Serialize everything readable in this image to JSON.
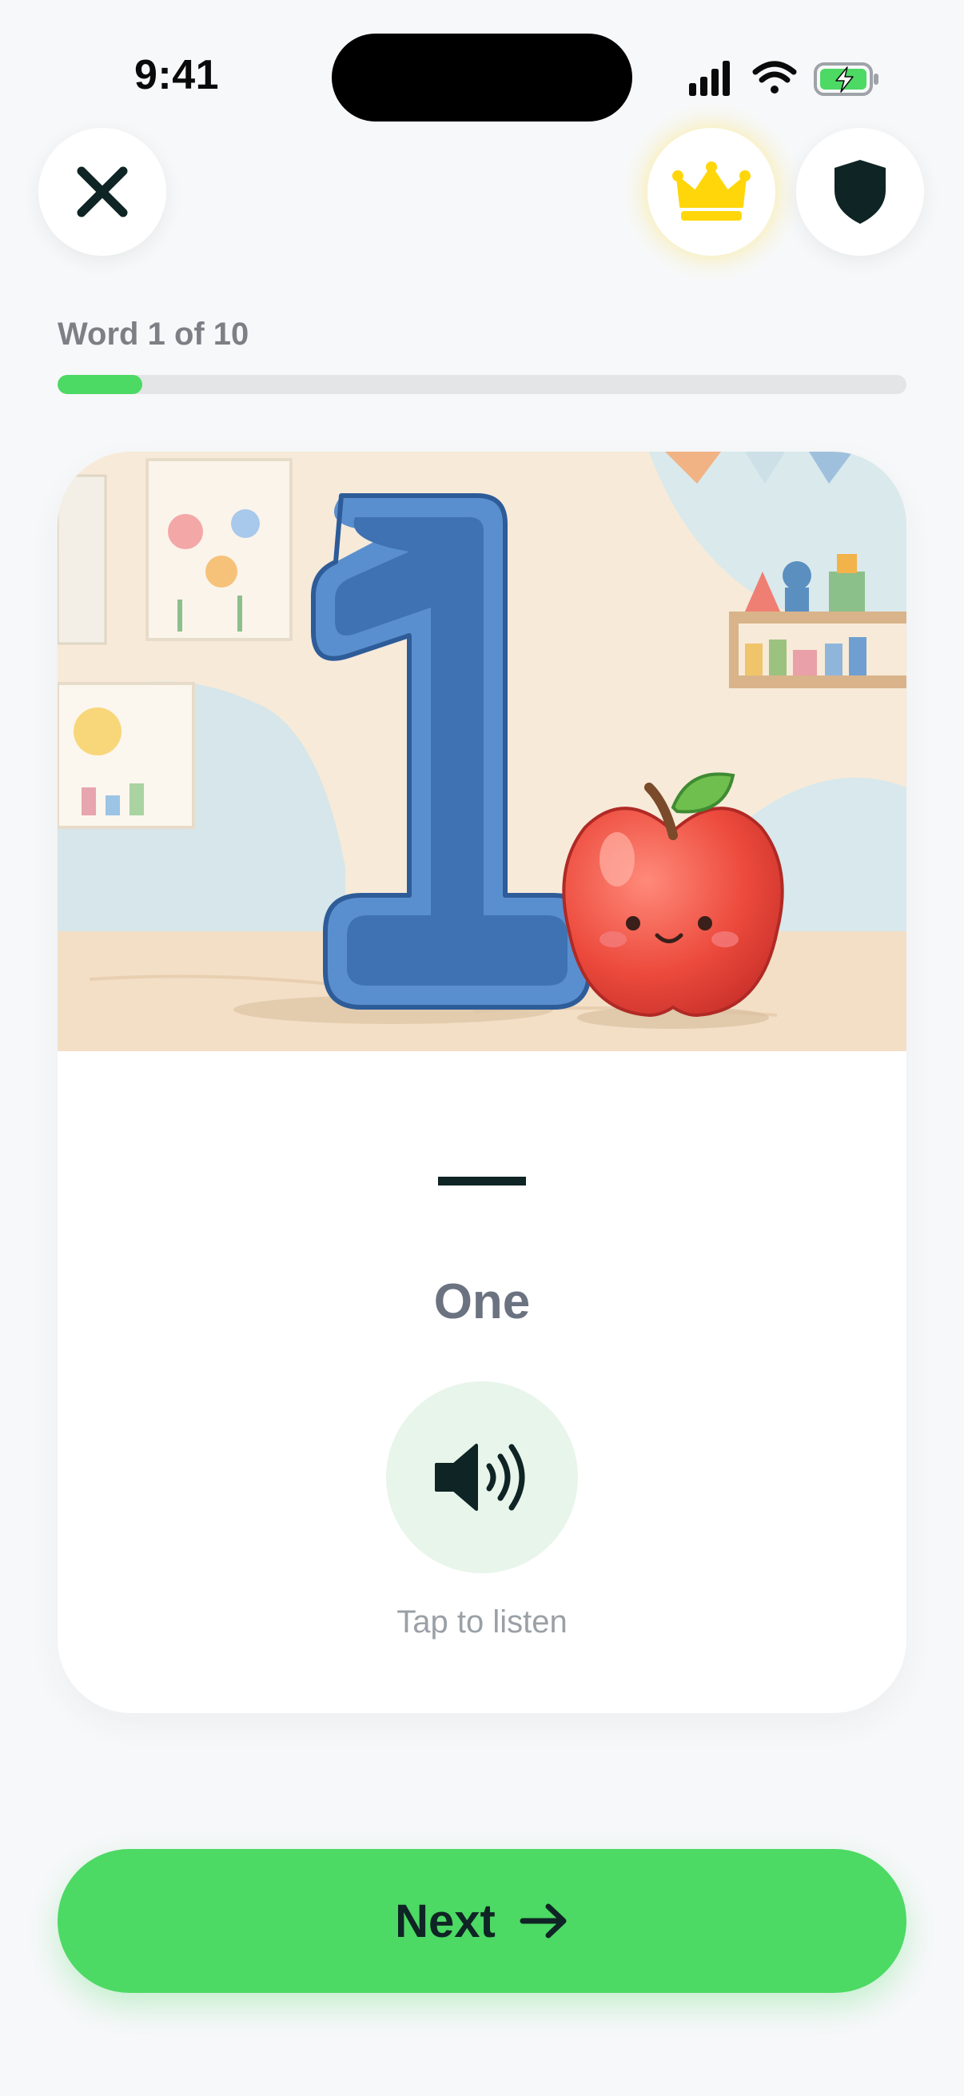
{
  "status_bar": {
    "time": "9:41",
    "battery_color": "#4cd964"
  },
  "top_bar": {
    "close_icon": "close-icon",
    "premium_icon": "crown-icon",
    "shield_icon": "shield-icon",
    "crown_color": "#ffd60a"
  },
  "progress": {
    "label": "Word 1 of 10",
    "current": 1,
    "total": 10,
    "fraction": 0.1
  },
  "card": {
    "illustration": "number-one-with-apple",
    "symbol": "—",
    "word": "One",
    "speaker_icon": "speaker-icon",
    "hint": "Tap to listen"
  },
  "next_button": {
    "label": "Next",
    "icon": "arrow-right-icon",
    "color": "#4cd964"
  }
}
